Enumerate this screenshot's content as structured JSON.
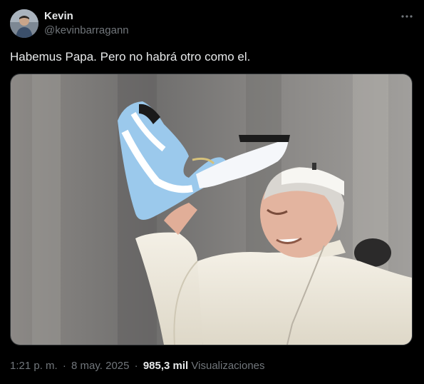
{
  "author": {
    "display_name": "Kevin",
    "handle": "@kevinbarragann"
  },
  "tweet": {
    "text": "Habemus Papa. Pero no habrá otro como el."
  },
  "media": {
    "icon": "photo-pope-waving-argentina-scarf"
  },
  "meta": {
    "time": "1:21 p. m.",
    "separator": "·",
    "date": "8 may. 2025",
    "views_count": "985,3 mil",
    "views_label": "Visualizaciones"
  },
  "colors": {
    "background": "#000000",
    "primary_text": "#e7e9ea",
    "secondary_text": "#71767b",
    "border": "#2f3336"
  }
}
